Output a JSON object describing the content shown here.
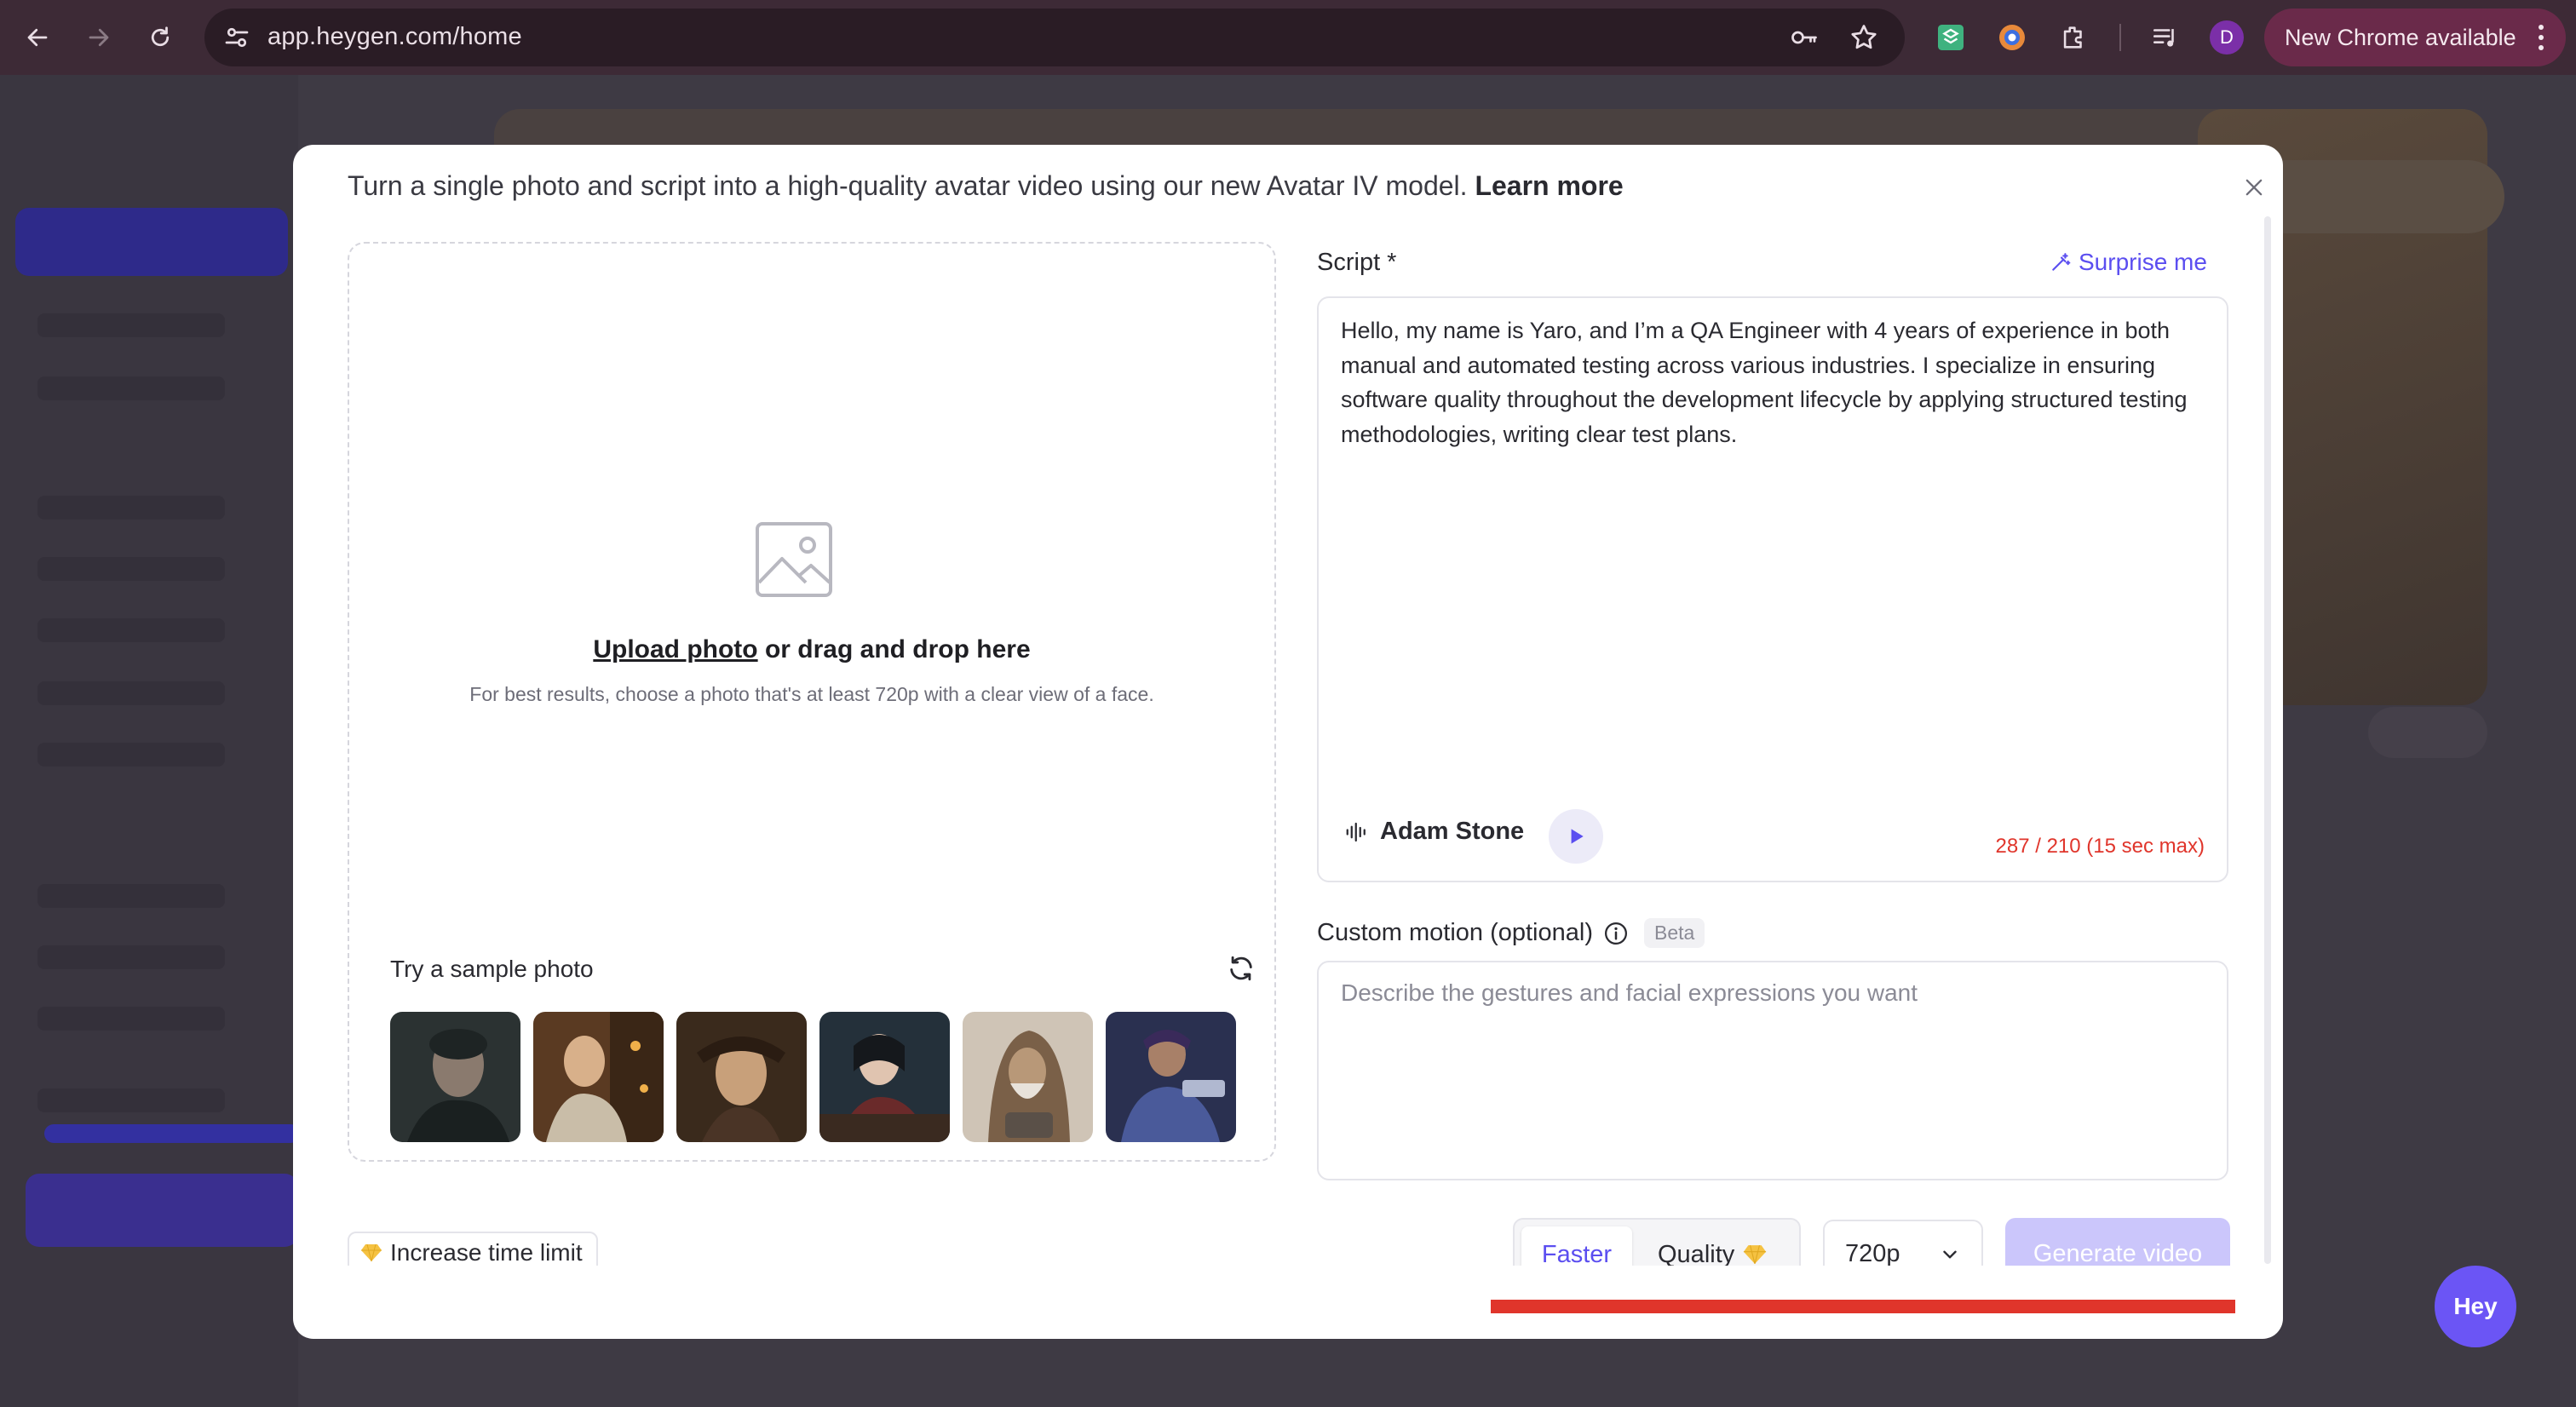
{
  "browser": {
    "url": "app.heygen.com/home",
    "profile_initial": "D",
    "update_label": "New Chrome available"
  },
  "modal": {
    "subtitle": "Turn a single photo and script into a high-quality avatar video using our new Avatar IV model.",
    "learn_more": "Learn more"
  },
  "upload": {
    "link_text": "Upload photo",
    "rest_text": " or drag and drop here",
    "hint": "For best results, choose a photo that's at least 720p with a clear view of a face.",
    "sample_label": "Try a sample photo"
  },
  "script": {
    "label": "Script *",
    "surprise_label": "Surprise me",
    "text": "Hello, my name is Yaro, and I’m a QA Engineer with 4 years of experience in both manual and automated testing across various industries. I specialize in ensuring software quality throughout the development lifecycle by applying structured testing methodologies, writing clear test plans.",
    "voice_name": "Adam Stone",
    "char_count": "287 / 210 (15 sec max)"
  },
  "motion": {
    "label": "Custom motion (optional)",
    "beta": "Beta",
    "placeholder": "Describe the gestures and facial expressions you want"
  },
  "footer": {
    "time_limit_label": "Increase time limit",
    "faster_label": "Faster",
    "quality_label": "Quality",
    "resolution": "720p",
    "generate_label": "Generate video"
  },
  "help": {
    "label": "Hey"
  },
  "colors": {
    "accent": "#5b4ef0",
    "error": "#e0352b",
    "premium": "#f5c242"
  }
}
